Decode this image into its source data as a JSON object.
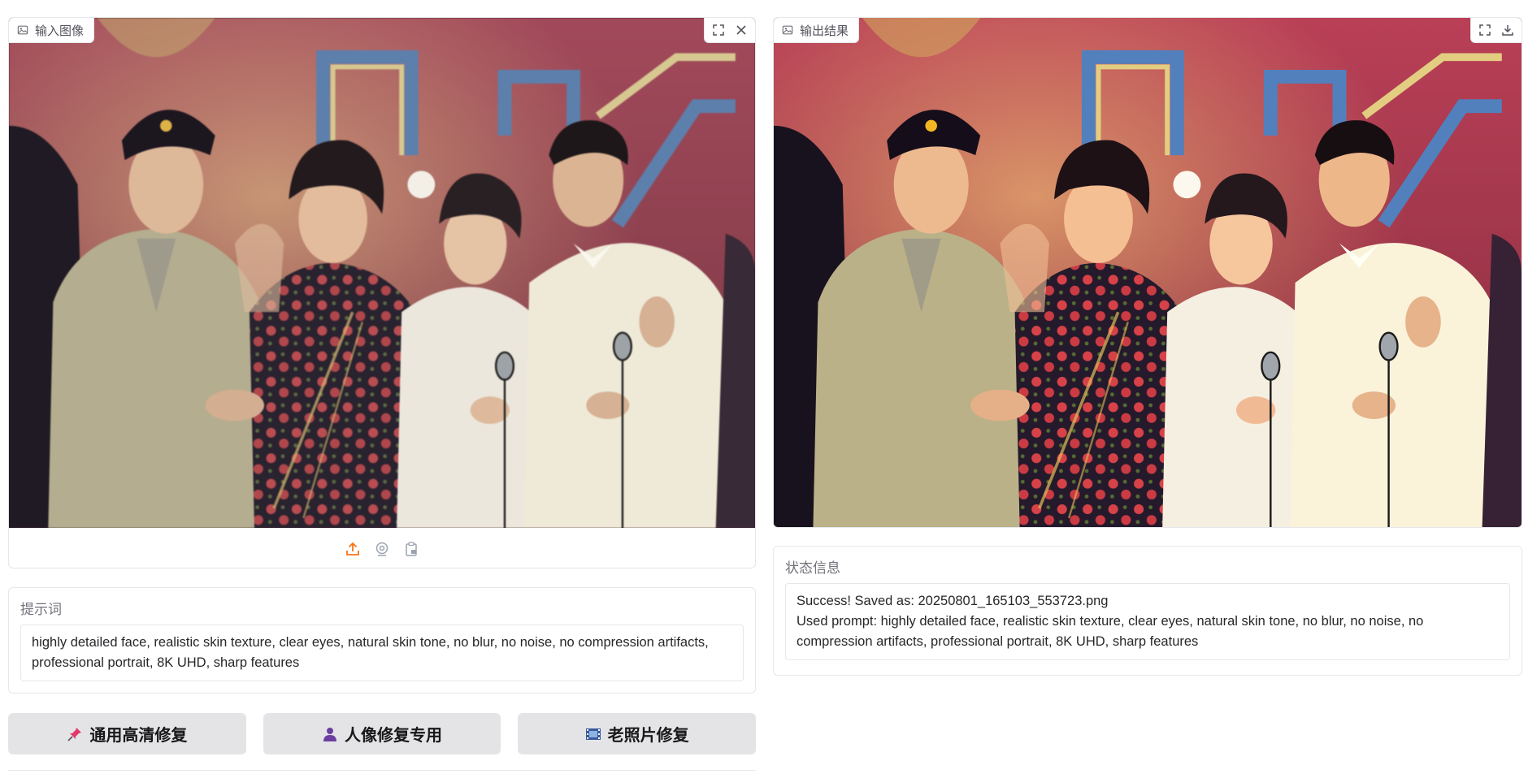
{
  "input_panel": {
    "label": "输入图像",
    "icons": {
      "label": "image-icon",
      "fullscreen": "fullscreen-icon",
      "close": "close-icon"
    },
    "sources": [
      "upload-icon",
      "webcam-icon",
      "clipboard-icon"
    ],
    "accent": "#f97316"
  },
  "output_panel": {
    "label": "输出结果",
    "icons": {
      "label": "image-icon",
      "fullscreen": "fullscreen-icon",
      "download": "download-icon"
    }
  },
  "prompt": {
    "label": "提示词",
    "value": "highly detailed face, realistic skin texture, clear eyes, natural skin tone, no blur, no noise, no compression artifacts, professional portrait, 8K UHD, sharp features"
  },
  "status": {
    "label": "状态信息",
    "line1": "Success! Saved as: 20250801_165103_553723.png",
    "line2": "Used prompt: highly detailed face, realistic skin texture, clear eyes, natural skin tone, no blur, no noise, no compression artifacts, professional portrait, 8K UHD, sharp features"
  },
  "buttons": [
    {
      "label": "通用高清修复",
      "icon": "pushpin-icon"
    },
    {
      "label": "人像修复专用",
      "icon": "person-icon"
    },
    {
      "label": "老照片修复",
      "icon": "film-icon"
    }
  ]
}
